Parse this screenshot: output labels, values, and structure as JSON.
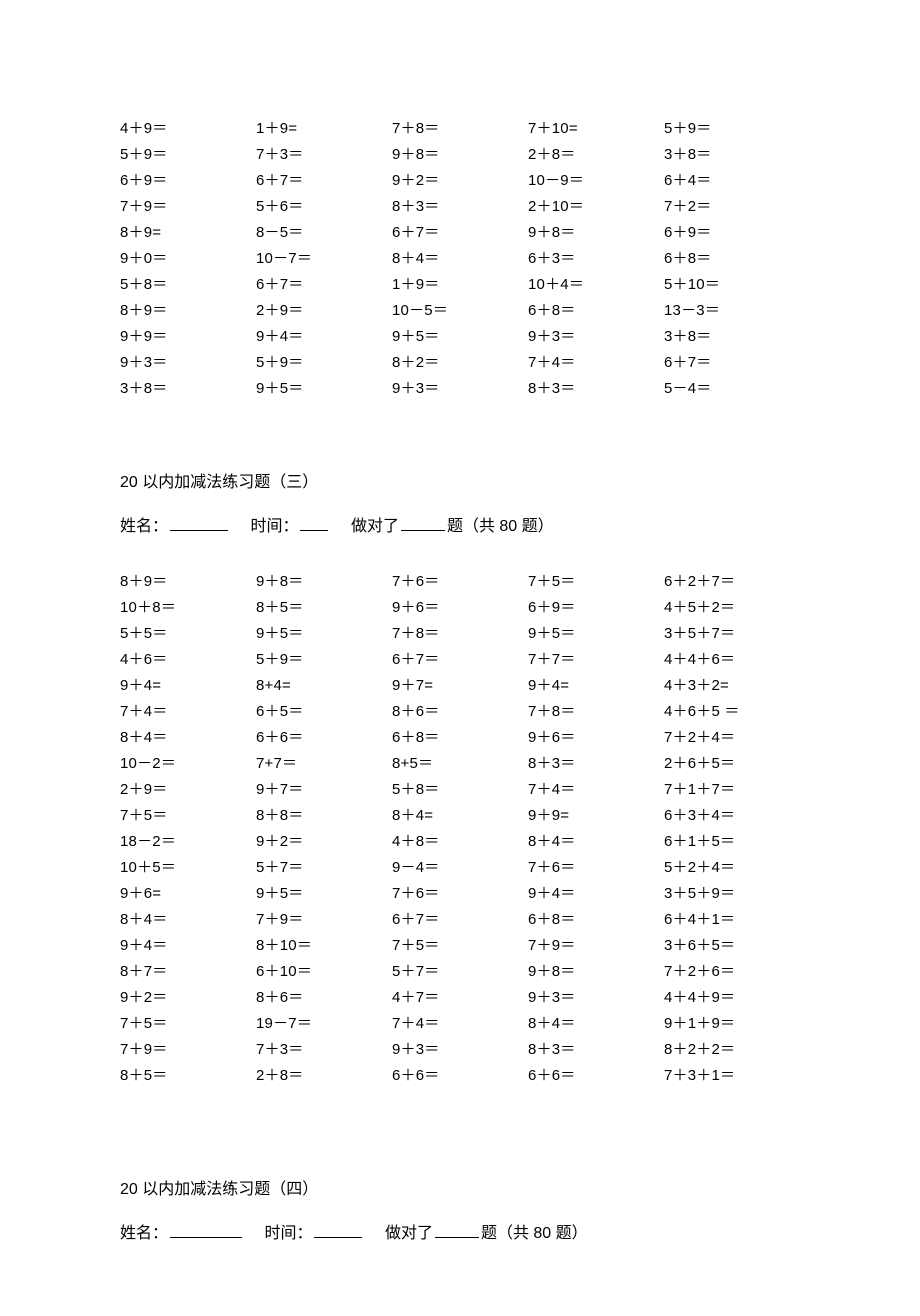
{
  "block1": {
    "cols": [
      [
        "4＋9＝",
        "5＋9＝",
        "6＋9＝",
        "7＋9＝",
        "8＋9=",
        "9＋0＝",
        "5＋8＝",
        "8＋9＝",
        "9＋9＝",
        "9＋3＝",
        "3＋8＝"
      ],
      [
        "1＋9=",
        "7＋3＝",
        "6＋7＝",
        "5＋6＝",
        "8－5＝",
        "10－7＝",
        "6＋7＝",
        "2＋9＝",
        "9＋4＝",
        "5＋9＝",
        "9＋5＝"
      ],
      [
        "7＋8＝",
        "9＋8＝",
        "9＋2＝",
        "8＋3＝",
        "6＋7＝",
        "8＋4＝",
        "1＋9＝",
        "10－5＝",
        "9＋5＝",
        "8＋2＝",
        "9＋3＝"
      ],
      [
        "7＋10=",
        "2＋8＝",
        "10－9＝",
        "2＋10＝",
        "9＋8＝",
        "6＋3＝",
        "10＋4＝",
        "6＋8＝",
        "9＋3＝",
        "7＋4＝",
        "8＋3＝"
      ],
      [
        "5＋9＝",
        "3＋8＝",
        "6＋4＝",
        "7＋2＝",
        "6＋9＝",
        "6＋8＝",
        "5＋10＝",
        "13－3＝",
        "3＋8＝",
        "6＋7＝",
        "5－4＝"
      ]
    ]
  },
  "section3": {
    "title": "20 以内加减法练习题（三）",
    "info_prefix": "姓名：",
    "info_time": "时间：",
    "info_correct": "做对了",
    "info_suffix": "题（共 80 题）"
  },
  "block2": {
    "cols": [
      [
        "8＋9＝",
        "10＋8＝",
        "5＋5＝",
        "4＋6＝",
        "9＋4=",
        "7＋4＝",
        "8＋4＝",
        "10－2＝",
        "2＋9＝",
        "7＋5＝",
        "18－2＝",
        "10＋5＝",
        "9＋6=",
        "8＋4＝",
        "9＋4＝",
        "8＋7＝",
        "9＋2＝",
        "7＋5＝",
        "7＋9＝",
        "8＋5＝"
      ],
      [
        "9＋8＝",
        "8＋5＝",
        "9＋5＝",
        "5＋9＝",
        "8+4=",
        "6＋5＝",
        "6＋6＝",
        "7+7＝",
        "9＋7＝",
        "8＋8＝",
        "9＋2＝",
        "5＋7＝",
        "9＋5＝",
        "7＋9＝",
        "8＋10＝",
        "6＋10＝",
        "8＋6＝",
        "19－7＝",
        "7＋3＝",
        "2＋8＝"
      ],
      [
        "7＋6＝",
        "9＋6＝",
        "7＋8＝",
        "6＋7＝",
        "9＋7=",
        "8＋6＝",
        "6＋8＝",
        "8+5＝",
        "5＋8＝",
        "8＋4=",
        "4＋8＝",
        "9－4＝",
        "7＋6＝",
        "6＋7＝",
        "7＋5＝",
        "5＋7＝",
        "4＋7＝",
        "7＋4＝",
        "9＋3＝",
        "6＋6＝"
      ],
      [
        "7＋5＝",
        "6＋9＝",
        "9＋5＝",
        "7＋7＝",
        "9＋4=",
        "7＋8＝",
        "9＋6＝",
        "8＋3＝",
        "7＋4＝",
        "9＋9=",
        "8＋4＝",
        "7＋6＝",
        "9＋4＝",
        "6＋8＝",
        "7＋9＝",
        "9＋8＝",
        "9＋3＝",
        "8＋4＝",
        "8＋3＝",
        "6＋6＝"
      ],
      [
        "6＋2＋7＝",
        "4＋5＋2＝",
        "3＋5＋7＝",
        "4＋4＋6＝",
        "4＋3＋2=",
        "4＋6＋5 ＝",
        "7＋2＋4＝",
        "2＋6＋5＝",
        "7＋1＋7＝",
        "6＋3＋4＝",
        "6＋1＋5＝",
        "5＋2＋4＝",
        "3＋5＋9＝",
        "6＋4＋1＝",
        "3＋6＋5＝",
        "7＋2＋6＝",
        "4＋4＋9＝",
        "9＋1＋9＝",
        "8＋2＋2＝",
        "7＋3＋1＝"
      ]
    ]
  },
  "section4": {
    "title": "20 以内加减法练习题（四）",
    "info_prefix": "姓名：",
    "info_time": "时间：",
    "info_correct": "做对了",
    "info_suffix": "题（共 80 题）"
  }
}
